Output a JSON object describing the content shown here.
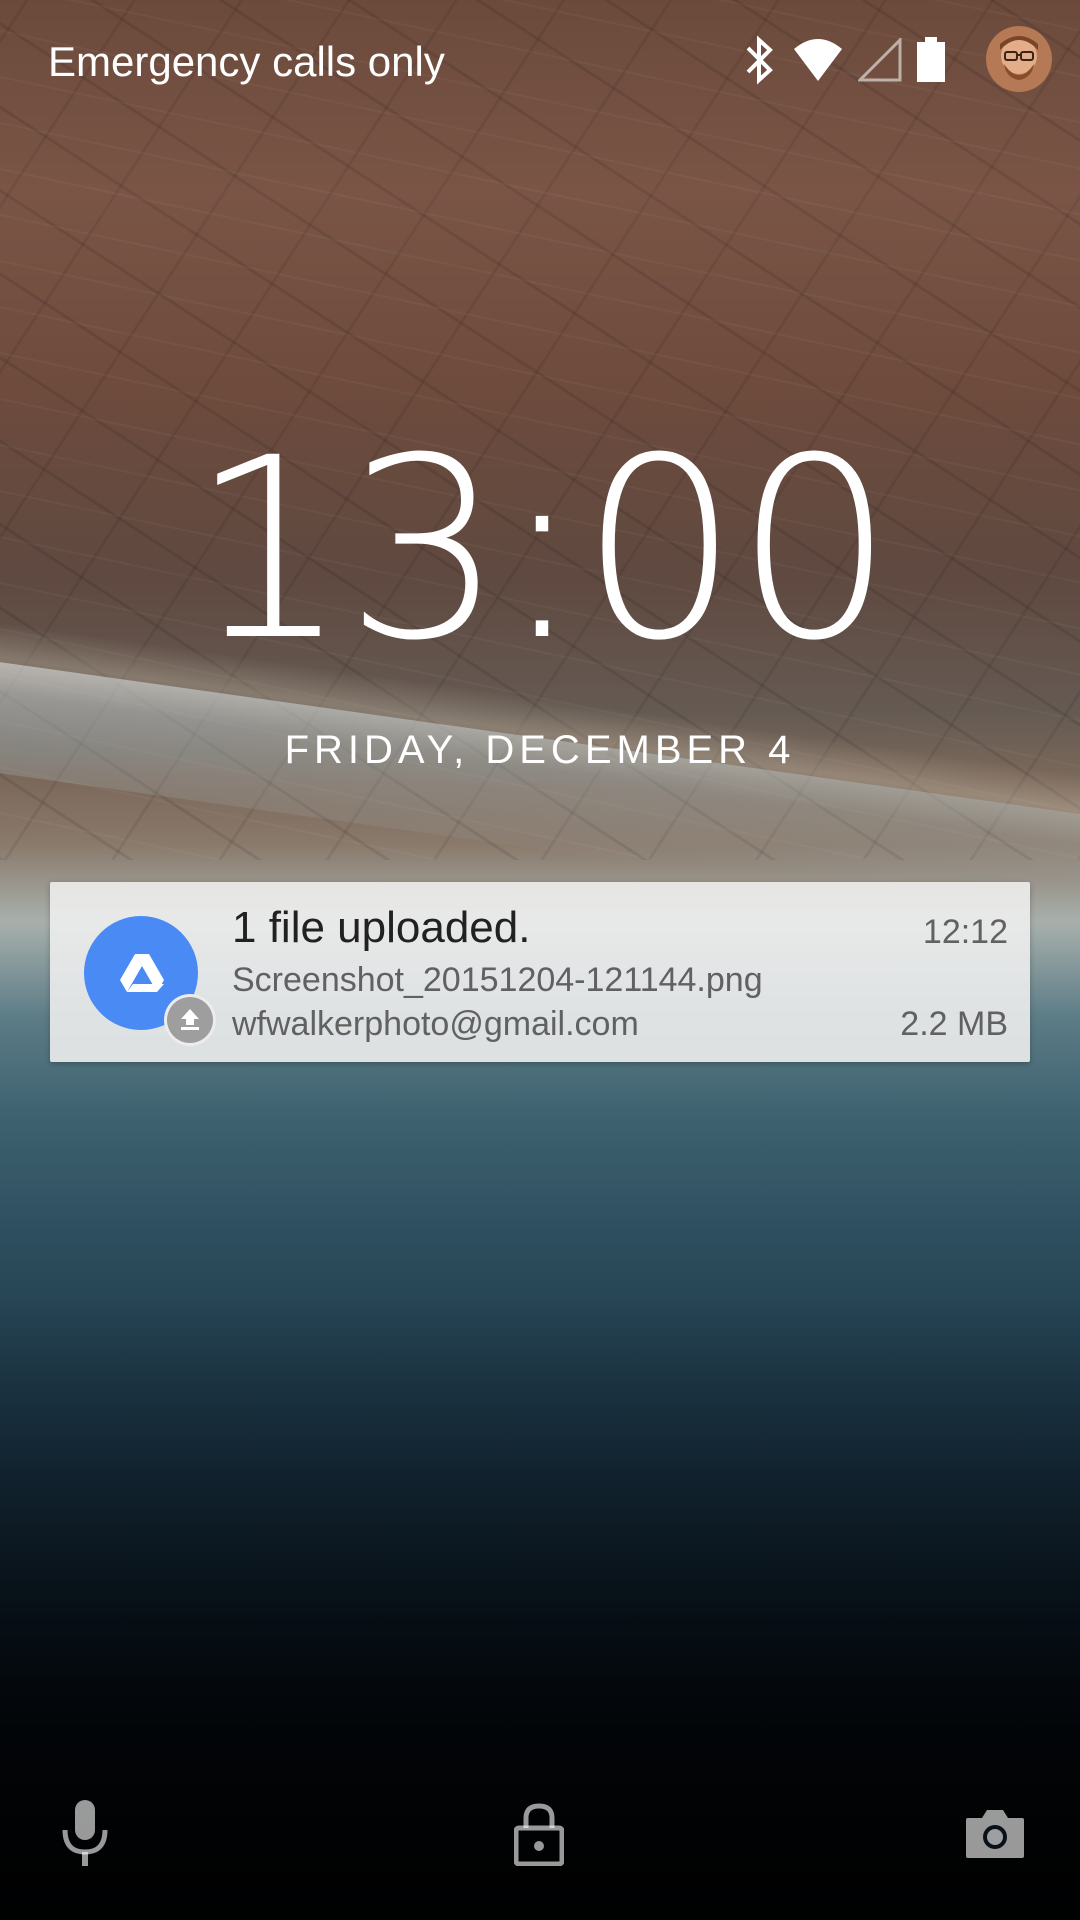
{
  "status_bar": {
    "carrier_text": "Emergency calls only",
    "icons": [
      "bluetooth-icon",
      "wifi-icon",
      "cellular-signal-icon",
      "battery-icon"
    ],
    "avatar": "user-avatar"
  },
  "lockscreen": {
    "time": "13:00",
    "date": "FRIDAY, DECEMBER 4"
  },
  "notification": {
    "app_icon": "google-drive-icon",
    "badge_icon": "upload-icon",
    "title": "1 file uploaded.",
    "time": "12:12",
    "file_name": "Screenshot_20151204-121144.png",
    "account": "wfwalkerphoto@gmail.com",
    "file_size": "2.2 MB",
    "accent_color": "#4a8af4"
  },
  "bottom_bar": {
    "left": "microphone-icon",
    "center": "lock-icon",
    "right": "camera-icon"
  }
}
